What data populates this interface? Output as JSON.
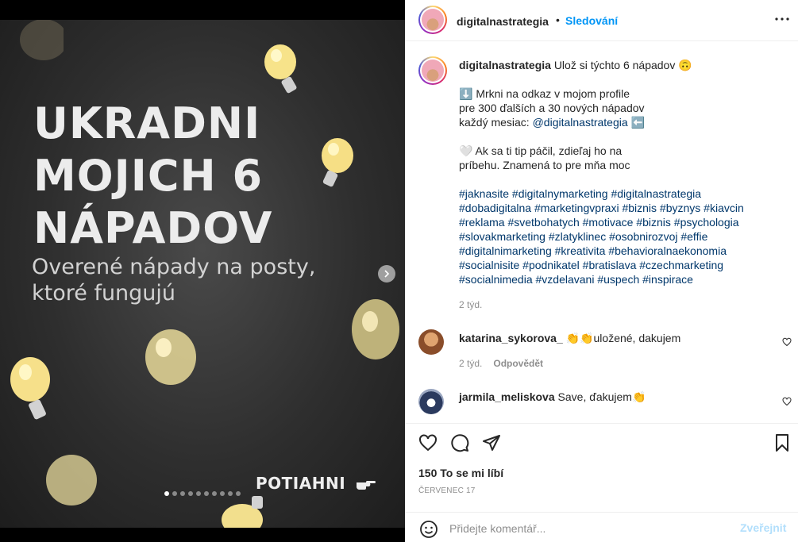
{
  "slide": {
    "headline": "UKRADNI\nMOJICH 6\nNÁPADOV",
    "subline": "Overené nápady na posty,\nktoré fungujú",
    "swipe_label": "POTIAHNI",
    "total_slides": 10,
    "active_slide": 1
  },
  "header": {
    "username": "digitalnastrategia",
    "separator": "•",
    "follow_label": "Sledování"
  },
  "caption": {
    "username": "digitalnastrategia",
    "first_line": "Ulož si týchto 6 nápadov 🙃",
    "para1": [
      "⬇️ Mrkni na odkaz v mojom profile",
      "pre 300 ďalších a 30 nových nápadov",
      "každý mesiac: "
    ],
    "mention": "@digitalnastrategia",
    "mention_suffix": " ⬅️",
    "para2": [
      "🤍 Ak sa ti tip páčil, zdieľaj ho na",
      "príbehu. Znamená to pre mňa moc"
    ],
    "hashtag_lines": [
      "#jaknasite #digitalnymarketing #digitalnastrategia",
      "#dobadigitalna #marketingvpraxi #biznis #byznys #kiavcin",
      "#reklama #svetbohatych #motivace #biznis #psychologia",
      "#slovakmarketing #zlatyklinec #osobnirozvoj #effie",
      "#digitalnimarketing #kreativita #behavioralnaekonomia",
      "#socialnisite #podnikatel #bratislava #czechmarketing",
      "#socialnimedia #vzdelavani #uspech #inspirace"
    ],
    "time": "2 týd."
  },
  "comments": [
    {
      "username": "katarina_sykorova_",
      "text": "👏👏uložené, dakujem",
      "time": "2 týd.",
      "reply_label": "Odpovědět"
    },
    {
      "username": "jarmila_meliskova",
      "text": "Save, ďakujem👏"
    }
  ],
  "actions": {
    "likes": "150 To se mi líbí",
    "date": "ČERVENEC 17"
  },
  "add_comment": {
    "placeholder": "Přidejte komentář...",
    "post_label": "Zveřejnit"
  },
  "colors": {
    "link_blue": "#0095f6",
    "hashtag": "#00376b",
    "muted": "#8e8e8e",
    "post_disabled": "#b2dffc"
  }
}
